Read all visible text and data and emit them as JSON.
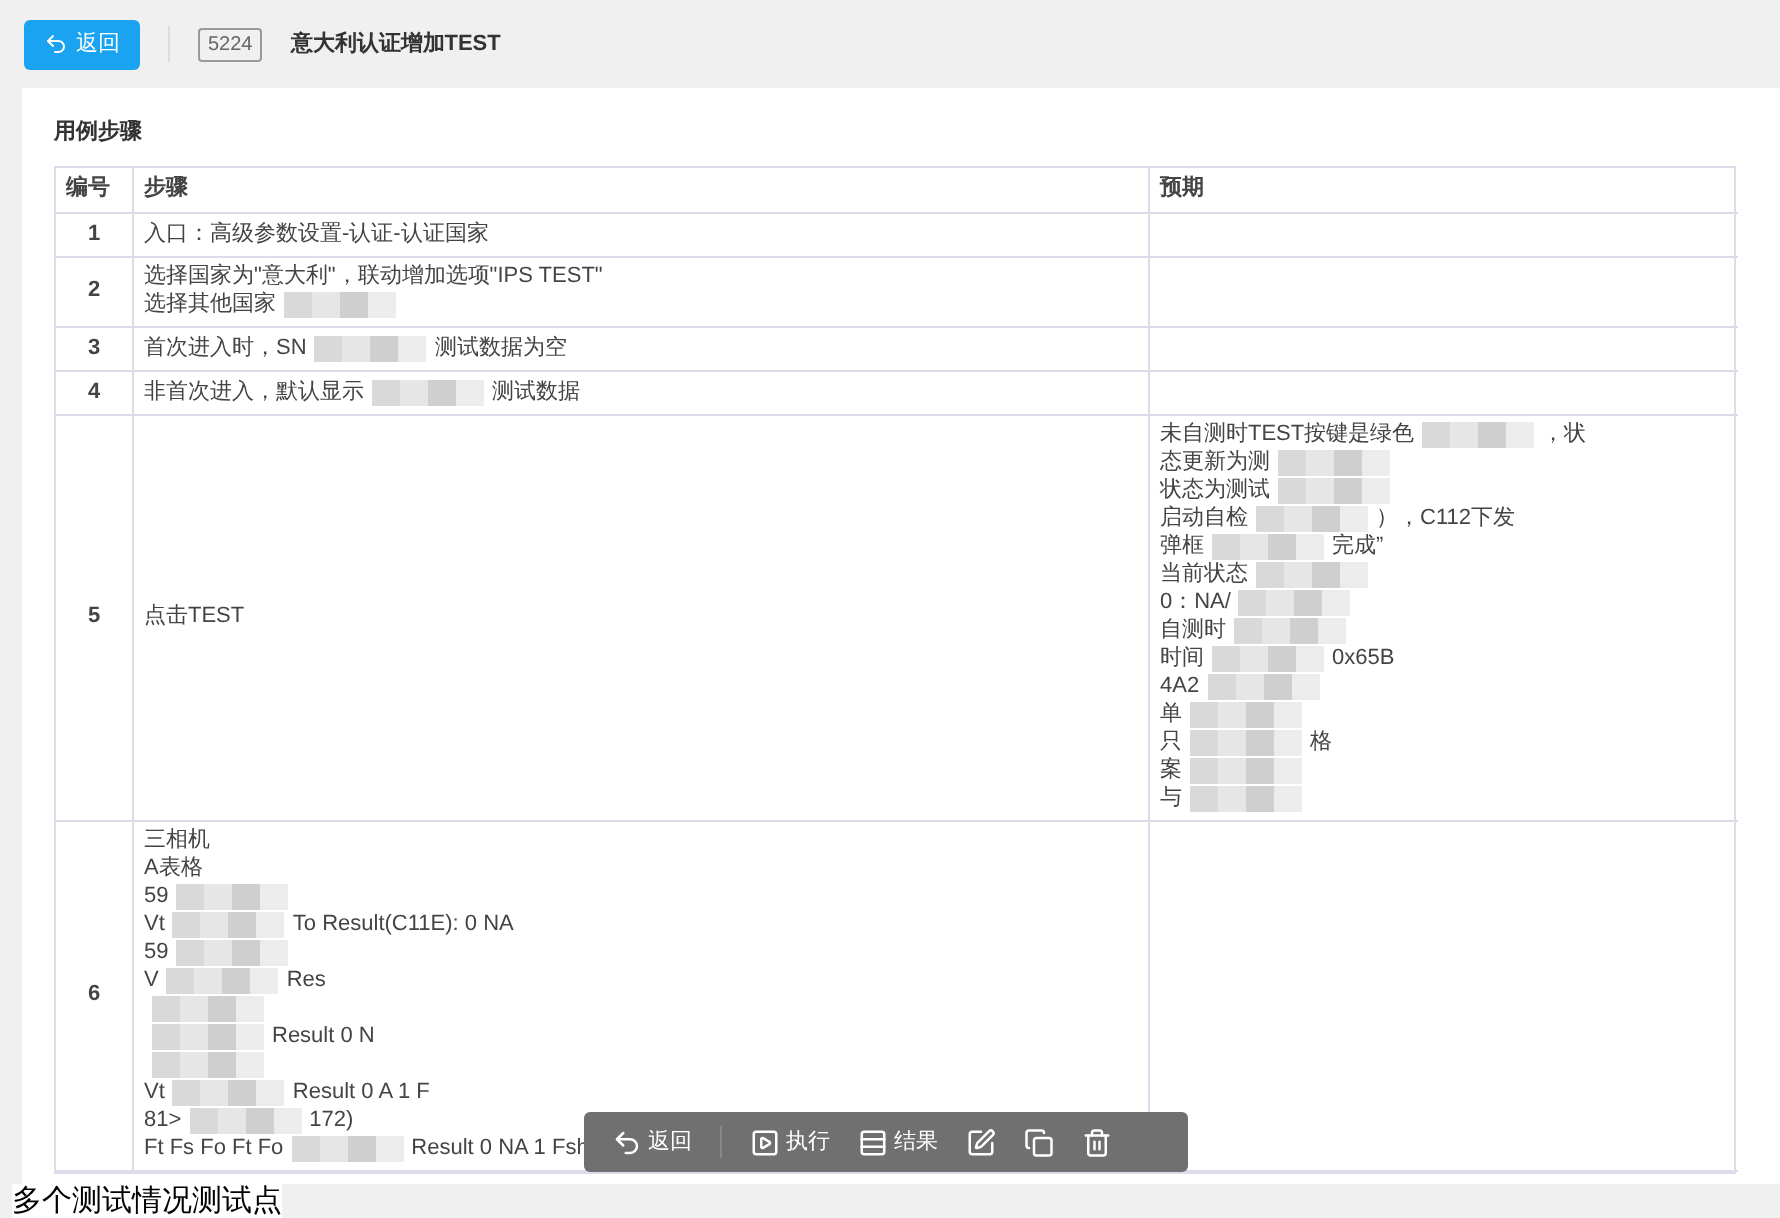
{
  "header": {
    "back_button": "返回",
    "case_id": "5224",
    "title": "意大利认证增加TEST"
  },
  "section_title": "用例步骤",
  "table": {
    "columns": [
      "编号",
      "步骤",
      "预期"
    ],
    "rows": [
      {
        "number": "1",
        "step": [
          {
            "text": "入口：高级参数设置-认证-认证国家"
          }
        ]
      },
      {
        "number": "2",
        "step": [
          {
            "text": "选择国家为\"意大利\"，联动增加选项\"IPS TEST\""
          },
          {
            "text": "选择其他国家",
            "redacted": true
          }
        ]
      },
      {
        "number": "3",
        "step": [
          {
            "text": "首次进入时，SN",
            "redacted": true,
            "tail": "测试数据为空"
          }
        ]
      },
      {
        "number": "4",
        "step": [
          {
            "text": "非首次进入，默认显示",
            "redacted": true,
            "tail": "测试数据"
          }
        ]
      },
      {
        "number": "5",
        "step": [
          {
            "text": "点击TEST"
          }
        ],
        "expected": [
          {
            "text": "未自测时TEST按键是绿色",
            "redacted": true,
            "tail": "，状"
          },
          {
            "text": "态更新为测",
            "redacted": true
          },
          {
            "text": "状态为测试",
            "redacted": true
          },
          {
            "text": "启动自检",
            "redacted": true,
            "tail": "），C112下发"
          },
          {
            "text": "弹框",
            "redacted": true,
            "tail": "完成”"
          },
          {
            "text": "当前状态",
            "redacted": true
          },
          {
            "text": "0：NA/",
            "redacted": true
          },
          {
            "text": "自测时",
            "redacted": true
          },
          {
            "text": "时间",
            "redacted": true,
            "tail": "0x65B"
          },
          {
            "text": "4A2",
            "redacted": true
          },
          {
            "text": "单",
            "redacted": true
          },
          {
            "text": "只",
            "redacted": true,
            "tail": "格"
          },
          {
            "text": "案",
            "redacted": true
          },
          {
            "text": "与",
            "redacted": true
          }
        ]
      },
      {
        "number": "6",
        "step": [
          {
            "text": "三相机"
          },
          {
            "text": "A表格"
          },
          {
            "text": "59",
            "redacted": true
          },
          {
            "text": "Vt",
            "redacted": true,
            "tail": "To   Result(C11E): 0 NA"
          },
          {
            "text": "59",
            "redacted": true
          },
          {
            "text": "V",
            "redacted": true,
            "tail": "Res"
          },
          {
            "redacted": true
          },
          {
            "redacted": true,
            "tail": "Result 0 N"
          },
          {
            "redacted": true
          },
          {
            "text": "Vt",
            "redacted": true,
            "tail": "Result 0 A 1 F"
          },
          {
            "text": "81>",
            "redacted": true,
            "tail": "172)"
          },
          {
            "text": "Ft Fs Fo Ft Fo",
            "redacted": true,
            "tail": "Result 0 NA 1 Fsh"
          }
        ]
      }
    ]
  },
  "toolbar": [
    {
      "kind": "back",
      "label": "返回"
    },
    {
      "kind": "run",
      "label": "执行"
    },
    {
      "kind": "result",
      "label": "结果"
    },
    {
      "kind": "edit"
    },
    {
      "kind": "copy"
    },
    {
      "kind": "delete"
    }
  ],
  "footer_text": "多个测试情况测试点"
}
